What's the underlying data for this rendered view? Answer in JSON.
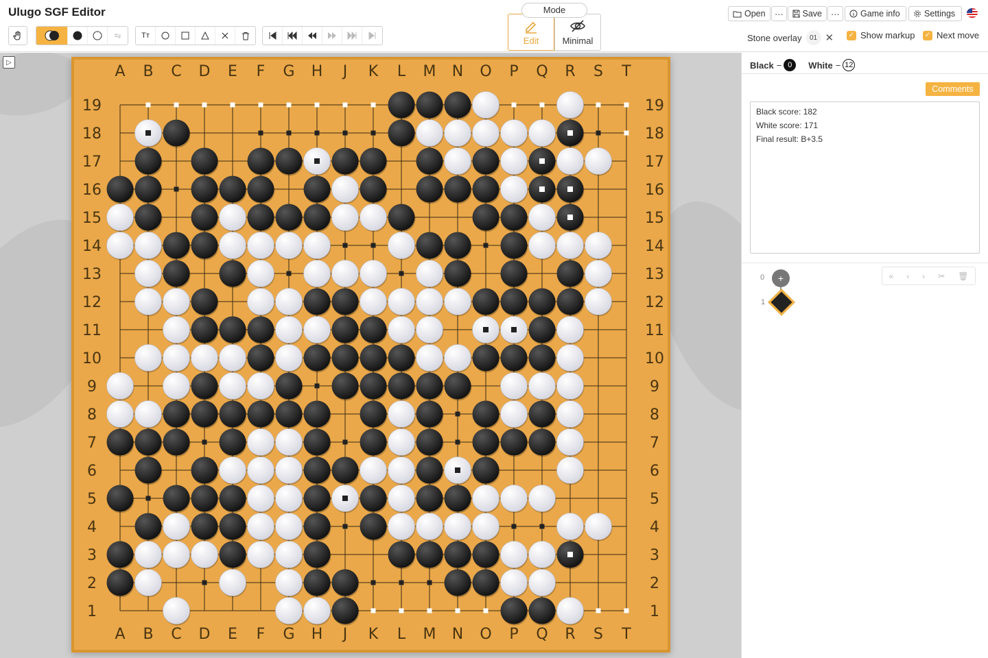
{
  "app": {
    "title": "Ulugo SGF Editor"
  },
  "toolbar": {
    "mode_label": "Mode",
    "edit_label": "Edit",
    "minimal_label": "Minimal",
    "open_label": "Open",
    "save_label": "Save",
    "more_label": "⋯",
    "game_info_label": "Game info",
    "settings_label": "Settings",
    "stone_overlay_label": "Stone overlay",
    "stone_overlay_value": "01",
    "show_markup_label": "Show markup",
    "next_move_label": "Next move"
  },
  "board": {
    "size": 19,
    "columns": [
      "A",
      "B",
      "C",
      "D",
      "E",
      "F",
      "G",
      "H",
      "J",
      "K",
      "L",
      "M",
      "N",
      "O",
      "P",
      "Q",
      "R",
      "S",
      "T"
    ],
    "rows": [
      "19",
      "18",
      "17",
      "16",
      "15",
      "14",
      "13",
      "12",
      "11",
      "10",
      "9",
      "8",
      "7",
      "6",
      "5",
      "4",
      "3",
      "2",
      "1"
    ],
    "position": [
      "..........BBBW..W..",
      ".WB.......BWWWWWB..",
      ".B.B.BBWBB.BWBWBWW.",
      "BB.BBB.BWB.BBBWBB..",
      "WB.BWBBBWWB..BBWB..",
      "WWBBWWWW..WBB.BWWW.",
      ".WB.BW.WWW.WB.B.BW.",
      ".WWB.WWBBWWWWBBBBW.",
      "..WBBBWWBBWW.WWBW..",
      ".WWWWBWBBBBWWBBBW..",
      "W.WBWWB.BBBBB.WWW..",
      "WWBBBBBB.BWB.BWBW..",
      "BBB.BWWB.BWB.BBBW..",
      ".B.BWWWBBWWBWB..W..",
      "B.BBBWWBWBWBBWWW...",
      ".BWBBWWB.BWWWW..WW.",
      "BWWWBWWB..BBBBWWB..",
      "BW..W.WBB...BBWW...",
      "..W...WWB.....BBW.."
    ],
    "stone_marks": [
      "B18",
      "H17",
      "Q17",
      "R18",
      "Q16",
      "R16",
      "R15",
      "O11",
      "P11",
      "N6",
      "J5",
      "R3"
    ],
    "empty_marks": [
      "B19",
      "C19",
      "D19",
      "E19",
      "F19",
      "G19",
      "H19",
      "J19",
      "K19",
      "P19",
      "Q19",
      "S19",
      "T19",
      "F18",
      "G18",
      "H18",
      "J18",
      "K18",
      "S18",
      "T18",
      "F16",
      "C16",
      "C14",
      "J14",
      "K14",
      "O14",
      "F13",
      "G13",
      "L13",
      "N9",
      "H9",
      "K8",
      "N8",
      "D7",
      "J7",
      "N7",
      "K6",
      "L6",
      "D5",
      "B5",
      "D4",
      "J4",
      "P4",
      "Q4",
      "D2",
      "J2",
      "K2",
      "L2",
      "M2",
      "N2",
      "O2",
      "J1",
      "K1",
      "L1",
      "M1",
      "N1",
      "O1",
      "S1",
      "T1"
    ]
  },
  "game": {
    "black_label": "Black",
    "white_label": "White",
    "black_captures": "0",
    "white_captures": "12",
    "captures_prefix": "−"
  },
  "comments": {
    "title": "Comments",
    "lines": [
      "Black score: 182",
      "White score: 171",
      "Final result: B+3.5"
    ]
  },
  "tree": {
    "root_num": "0",
    "move_num": "1",
    "root_symbol": "+"
  },
  "colors": {
    "accent": "#f5b342",
    "board": "#eaa84a",
    "border": "#d9952f"
  }
}
